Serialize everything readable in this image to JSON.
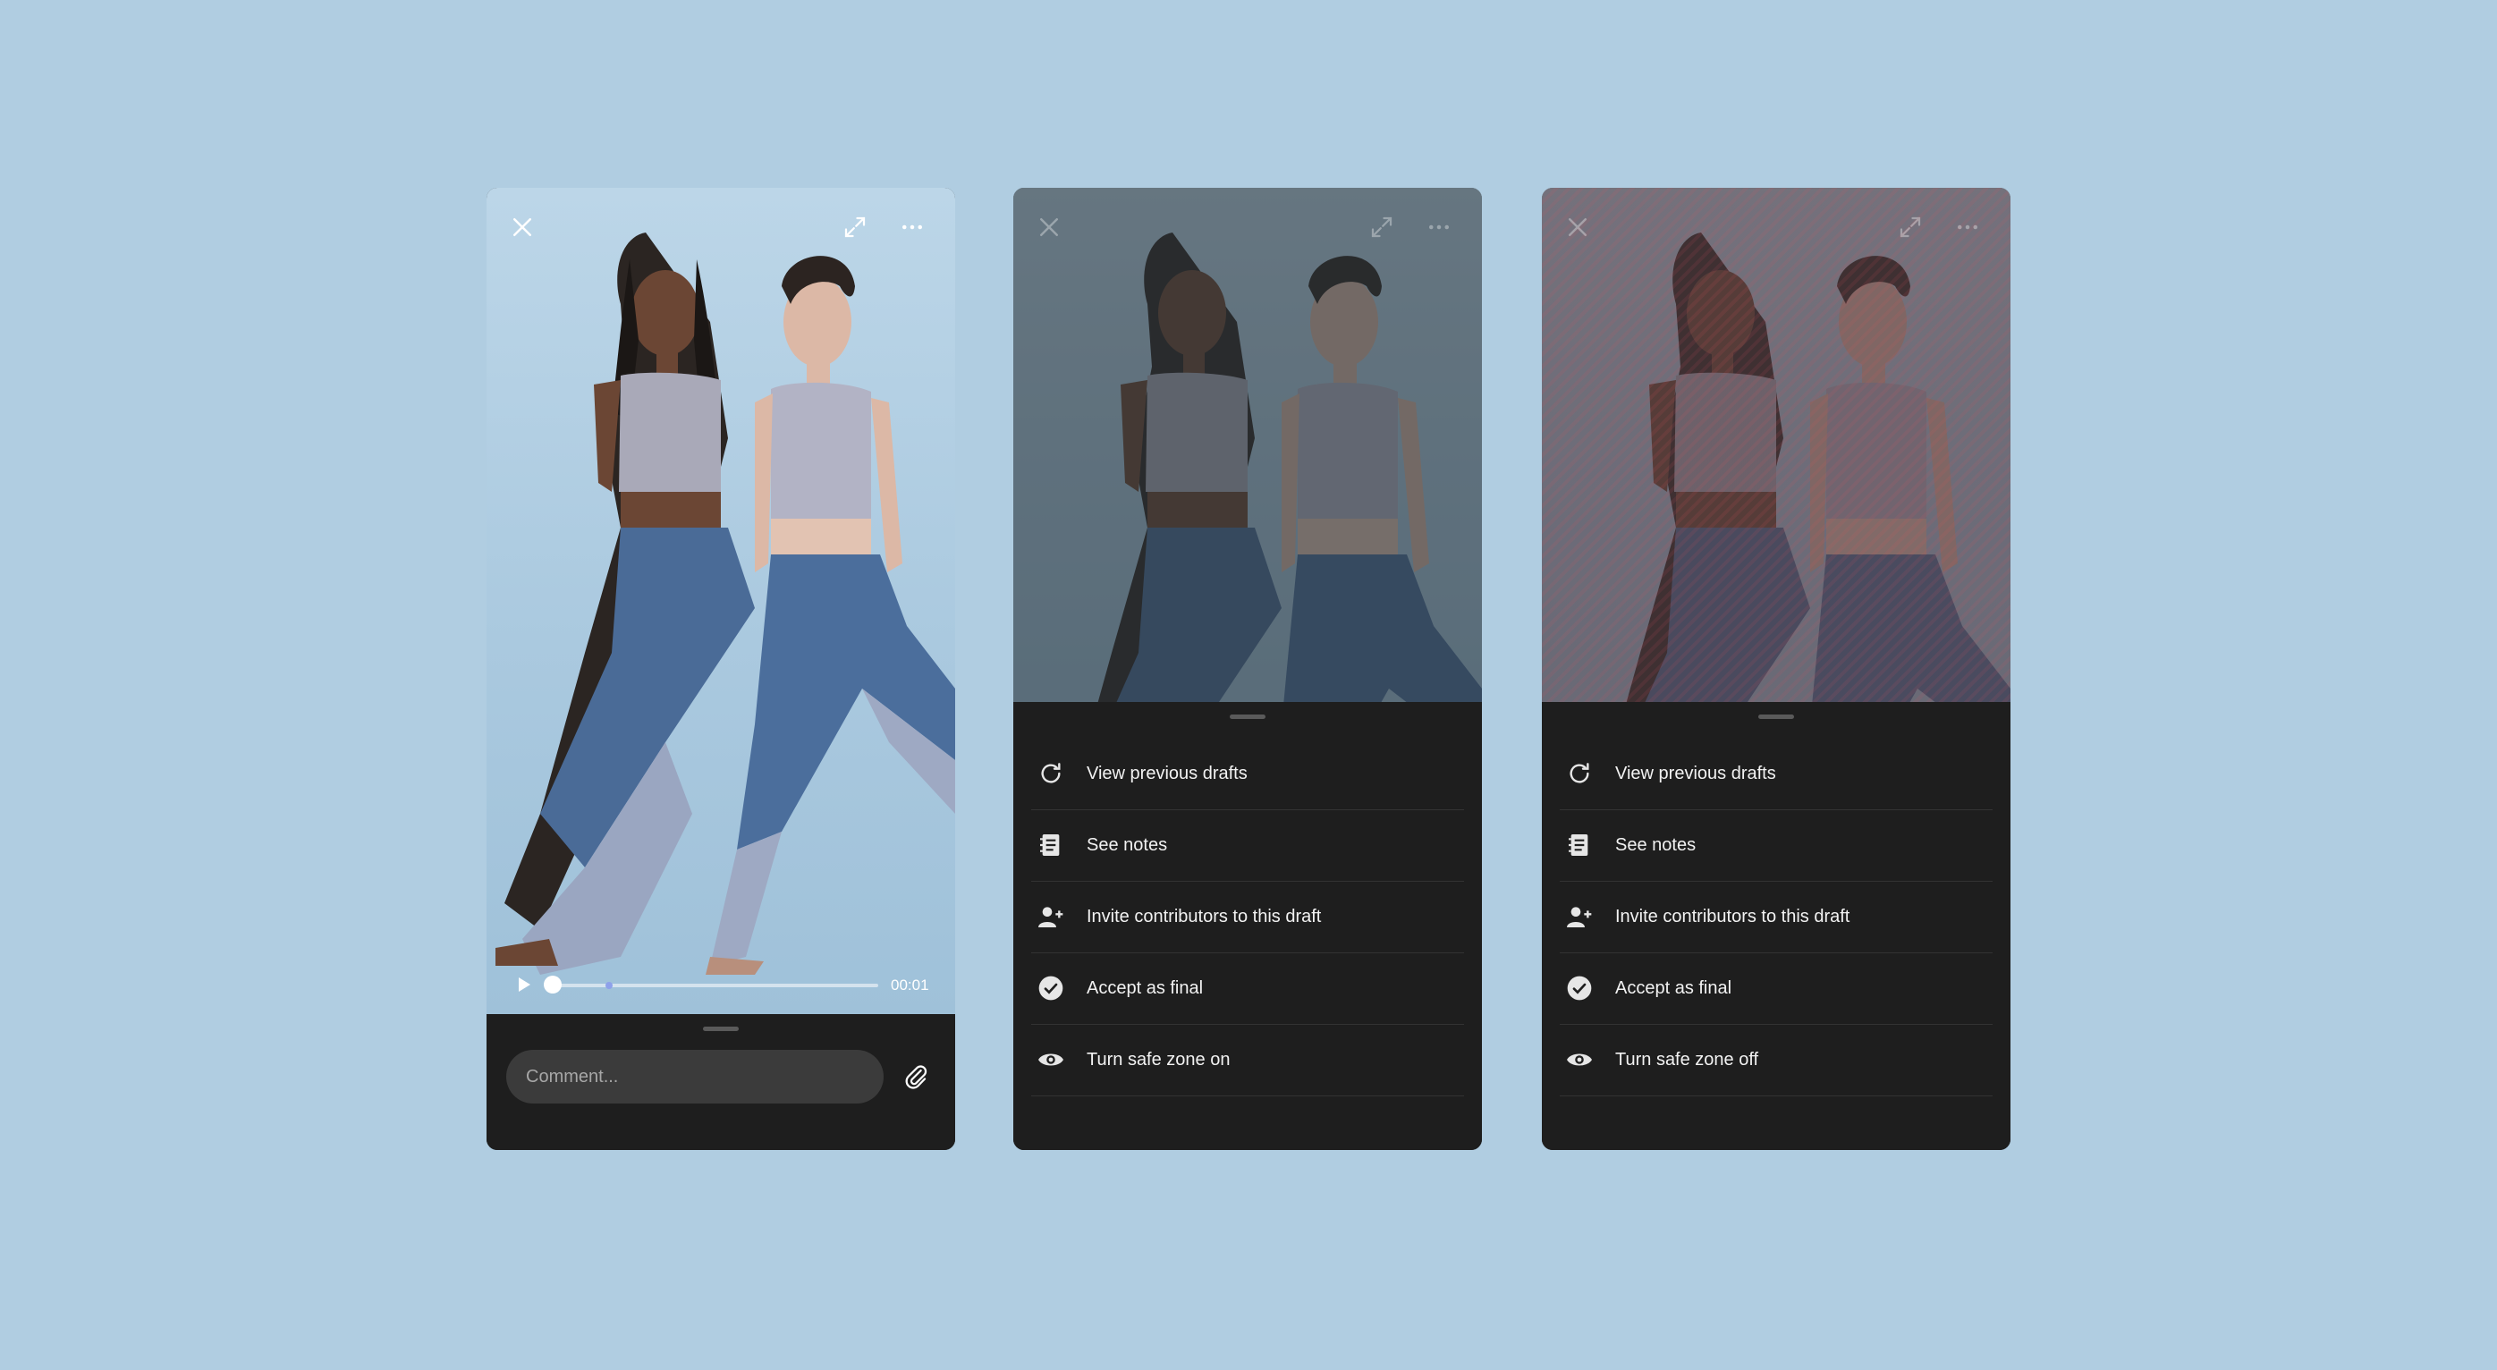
{
  "colors": {
    "background": "#b0cde1",
    "sheet": "#1e1e1e",
    "field": "#3b3b3b",
    "text": "#f2f2f2",
    "marker": "#8ea1ea",
    "safe_zone": "#dc505a"
  },
  "player": {
    "time": "00:01",
    "progress": 0.02
  },
  "comment": {
    "placeholder": "Comment..."
  },
  "icons": {
    "close": "close-icon",
    "expand": "expand-icon",
    "more": "more-icon",
    "play": "play-icon",
    "attach": "paperclip-icon"
  },
  "menu_items": [
    {
      "label": "View previous drafts",
      "icon": "refresh-icon"
    },
    {
      "label": "See notes",
      "icon": "notes-icon"
    },
    {
      "label": "Invite contributors to this draft",
      "icon": "add-user-icon"
    },
    {
      "label": "Accept as final",
      "icon": "check-circle-icon"
    }
  ],
  "screen2": {
    "safe_zone_label": "Turn safe zone on"
  },
  "screen3": {
    "safe_zone_label": "Turn safe zone off"
  }
}
